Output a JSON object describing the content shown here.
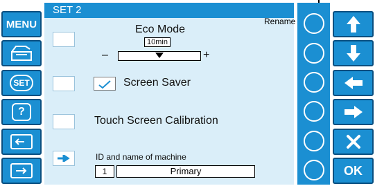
{
  "left_buttons": {
    "menu_label": "MENU",
    "set_label": "SET",
    "help_label": "?"
  },
  "panel": {
    "title": "SET 2",
    "eco_mode": {
      "label": "Eco Mode",
      "value": "10min",
      "minus": "–",
      "plus": "+"
    },
    "screen_saver": {
      "label": "Screen Saver",
      "checked": true
    },
    "touch_calibration": {
      "label": "Touch Screen Calibration"
    },
    "machine": {
      "label": "ID and name of machine",
      "id": "1",
      "name": "Primary"
    }
  },
  "right_column": {
    "rename_label": "Rename"
  },
  "arrow_buttons": {
    "ok_label": "OK"
  },
  "colors": {
    "accent": "#1b8fd2",
    "border": "#0a4f80",
    "panel_bg": "#daeef9"
  }
}
